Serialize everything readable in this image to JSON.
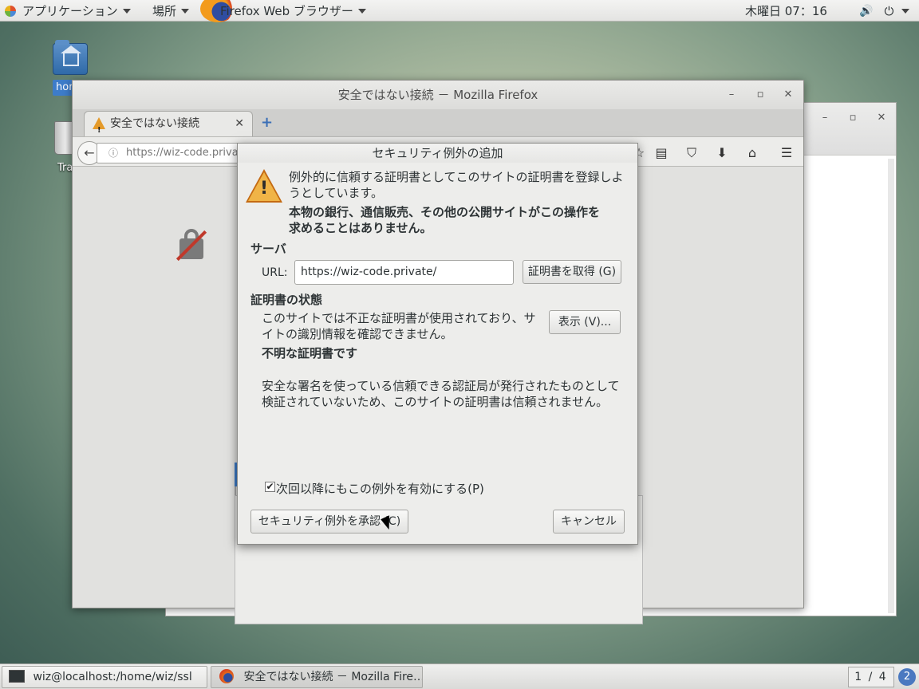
{
  "topbar": {
    "apps_menu": "アプリケーション",
    "places_menu": "場所",
    "active_app": "Firefox Web ブラウザー",
    "clock": "木曜日 07：16"
  },
  "desktop": {
    "home_label": "hom",
    "trash_label": "Tra"
  },
  "firefox": {
    "window_title": "安全ではない接続 － Mozilla Firefox",
    "tab_title": "安全ではない接続",
    "url": "https://wiz-code.priva"
  },
  "dialog": {
    "title": "セキュリティ例外の追加",
    "intro": "例外的に信頼する証明書としてこのサイトの証明書を登録しようとしています。",
    "intro_line1": "例外的に信頼する証明書としてこのサイトの証明書を登録しよ",
    "intro_line2": "うとしています。",
    "warning_line1": "本物の銀行、通信販売、その他の公開サイトがこの操作を",
    "warning_line2": "求めることはありません。",
    "server_heading": "サーバ",
    "url_label": "URL:",
    "url_value": "https://wiz-code.private/",
    "get_cert_button": "証明書を取得 (G)",
    "cert_status_heading": "証明書の状態",
    "status_line1": "このサイトでは不正な証明書が使用されており、サ",
    "status_line2": "イトの識別情報を確認できません。",
    "view_button": "表示 (V)...",
    "unknown_cert": "不明な証明書です",
    "detail_line1": "安全な署名を使っている信頼できる認証局が発行されたものとして",
    "detail_line2": "検証されていないため、このサイトの証明書は信頼されません。",
    "permanent_checkbox": "次回以降にもこの例外を有効にする(P)",
    "confirm_button": "セキュリティ例外を承認 (C)",
    "cancel_button": "キャンセル"
  },
  "taskbar": {
    "terminal_task": "wiz@localhost:/home/wiz/ssl",
    "firefox_task": "安全ではない接続 － Mozilla Fire…",
    "workspace": "1 / 4",
    "help": "2"
  }
}
